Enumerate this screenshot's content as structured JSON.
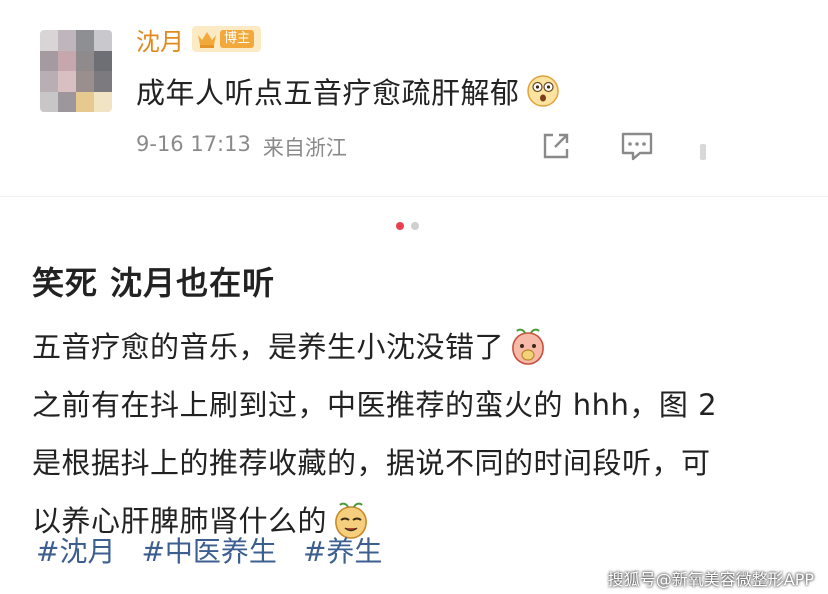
{
  "post": {
    "author": "沈月",
    "badge": "博主",
    "text": "成年人听点五音疗愈疏肝解郁",
    "time": "9-16 17:13",
    "location": "来自浙江"
  },
  "carousel": {
    "count": 2,
    "active": 0
  },
  "article": {
    "headline": "笑死 沈月也在听",
    "lines": [
      "五音疗愈的音乐，是养生小沈没错了",
      "之前有在抖上刷到过，中医推荐的蛮火的 hhh，图 2",
      "是根据抖上的推荐收藏的，据说不同的时间段听，可",
      "以养心肝脾肺肾什么的"
    ],
    "tags": [
      "#沈月",
      "#中医养生",
      "#养生"
    ]
  },
  "watermark": "搜狐号@新氧美容微整形APP",
  "colors": {
    "author": "#e08a1e",
    "tag": "#3d5f8f",
    "dot_active": "#e8404e",
    "meta": "#8a8a8a"
  }
}
